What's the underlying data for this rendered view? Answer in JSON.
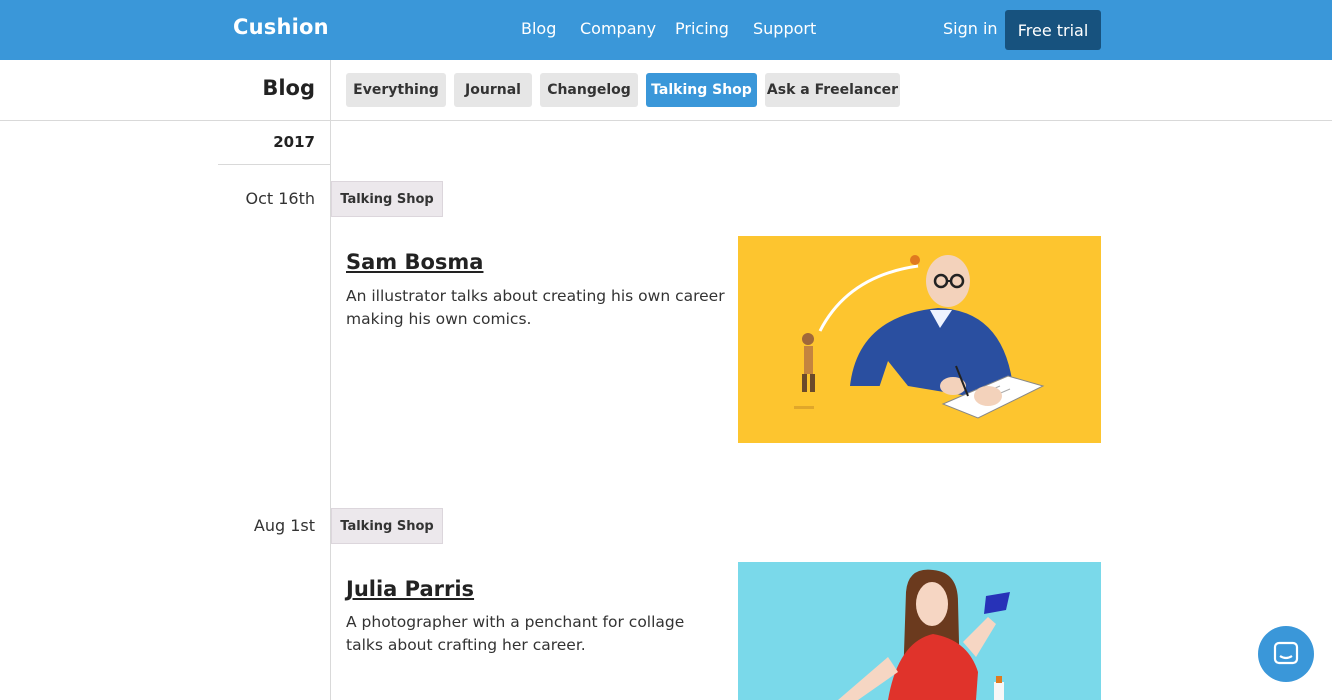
{
  "header": {
    "logo": "Cushion",
    "nav": [
      "Blog",
      "Company",
      "Pricing",
      "Support"
    ],
    "signin": "Sign in",
    "cta": "Free trial"
  },
  "blog": {
    "title": "Blog",
    "filters": [
      "Everything",
      "Journal",
      "Changelog",
      "Talking Shop",
      "Ask a Freelancer"
    ],
    "active_filter": "Talking Shop"
  },
  "year": "2017",
  "posts": [
    {
      "date": "Oct 16th",
      "tag": "Talking Shop",
      "title": "Sam Bosma",
      "description": "An illustrator talks about creating his own career making his own comics.",
      "image_bg": "#fdc52f"
    },
    {
      "date": "Aug 1st",
      "tag": "Talking Shop",
      "title": "Julia Parris",
      "description": "A photographer with a penchant for collage talks about crafting her career.",
      "image_bg": "#7ad9ea"
    }
  ],
  "colors": {
    "brand": "#3a97d9",
    "cta": "#17527e"
  },
  "chat_icon": "chat-bubble-icon"
}
